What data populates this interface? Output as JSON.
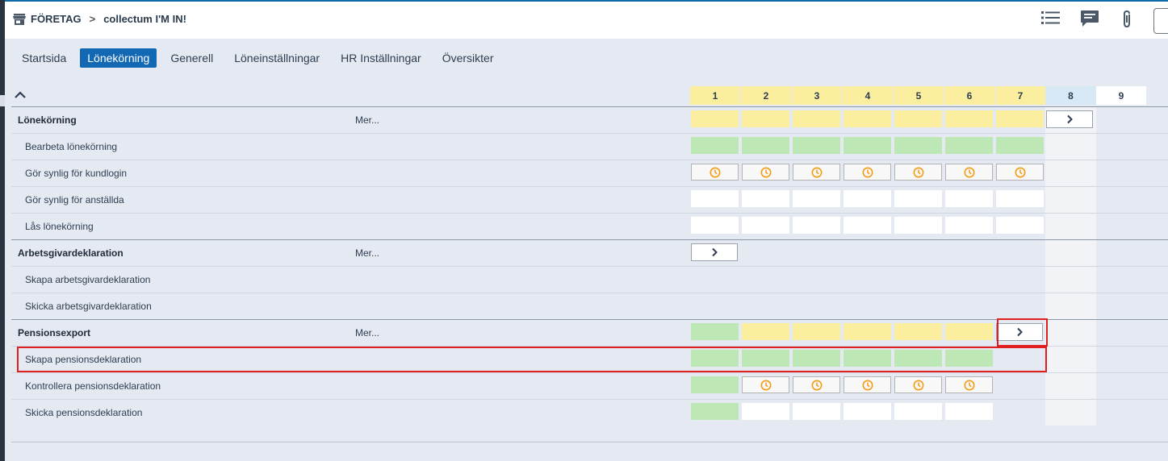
{
  "breadcrumb": {
    "company": "FÖRETAG",
    "separator": ">",
    "client": "collectum I'M IN!"
  },
  "toolbar": {
    "icons": [
      "list-icon",
      "chat-icon",
      "paperclip-icon"
    ]
  },
  "tabs": [
    {
      "label": "Startsida",
      "active": false
    },
    {
      "label": "Lönekörning",
      "active": true
    },
    {
      "label": "Generell",
      "active": false
    },
    {
      "label": "Löneinställningar",
      "active": false
    },
    {
      "label": "HR Inställningar",
      "active": false
    },
    {
      "label": "Översikter",
      "active": false
    }
  ],
  "columns": [
    "1",
    "2",
    "3",
    "4",
    "5",
    "6",
    "7",
    "8",
    "9"
  ],
  "more_label": "Mer...",
  "sections": [
    {
      "title": "Lönekörning",
      "cells": [
        "yellow",
        "yellow",
        "yellow",
        "yellow",
        "yellow",
        "yellow",
        "yellow",
        "arrow"
      ],
      "rows": [
        {
          "label": "Bearbeta lönekörning",
          "cells": [
            "green",
            "green",
            "green",
            "green",
            "green",
            "green",
            "green"
          ]
        },
        {
          "label": "Gör synlig för kundlogin",
          "cells": [
            "clock",
            "clock",
            "clock",
            "clock",
            "clock",
            "clock",
            "clock"
          ]
        },
        {
          "label": "Gör synlig för anställda",
          "cells": [
            "white",
            "white",
            "white",
            "white",
            "white",
            "white",
            "white"
          ]
        },
        {
          "label": "Lås lönekörning",
          "cells": [
            "white",
            "white",
            "white",
            "white",
            "white",
            "white",
            "white"
          ]
        }
      ]
    },
    {
      "title": "Arbetsgivardeklaration",
      "cells": [
        "arrow"
      ],
      "rows": [
        {
          "label": "Skapa arbetsgivardeklaration",
          "cells": []
        },
        {
          "label": "Skicka arbetsgivardeklaration",
          "cells": []
        }
      ]
    },
    {
      "title": "Pensionsexport",
      "cells": [
        "green",
        "yellow",
        "yellow",
        "yellow",
        "yellow",
        "yellow",
        "arrow"
      ],
      "rows": [
        {
          "label": "Skapa pensionsdeklaration",
          "cells": [
            "green",
            "green",
            "green",
            "green",
            "green",
            "green"
          ]
        },
        {
          "label": "Kontrollera pensionsdeklaration",
          "cells": [
            "green",
            "clock",
            "clock",
            "clock",
            "clock",
            "clock"
          ]
        },
        {
          "label": "Skicka pensionsdeklaration",
          "cells": [
            "green",
            "white",
            "white",
            "white",
            "white",
            "white"
          ]
        }
      ]
    }
  ],
  "colors": {
    "accent": "#1268b3",
    "yellow": "#fbee9f",
    "green": "#bde8b5",
    "highlight": "#e02020",
    "clock": "#f39c12"
  }
}
